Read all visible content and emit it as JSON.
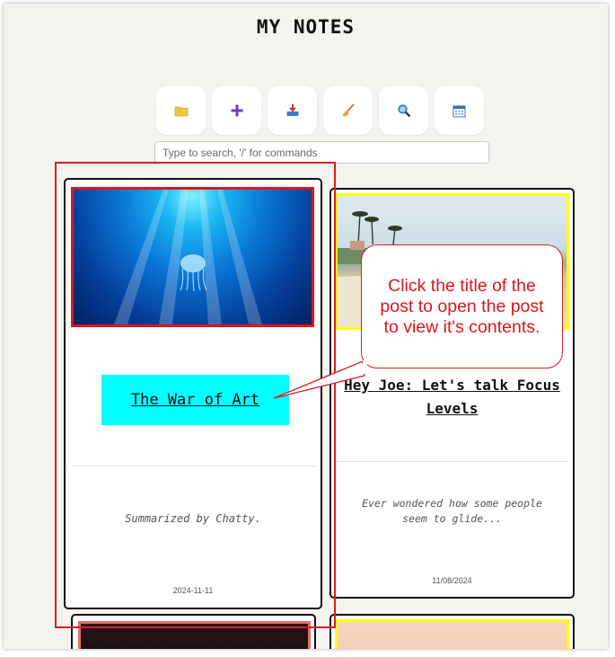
{
  "app": {
    "title": "MY NOTES"
  },
  "toolbar": {
    "buttons": [
      {
        "name": "folder",
        "icon": "folder-icon"
      },
      {
        "name": "add",
        "icon": "plus-icon"
      },
      {
        "name": "inbox",
        "icon": "inbox-tray-icon"
      },
      {
        "name": "clean",
        "icon": "broom-icon"
      },
      {
        "name": "search",
        "icon": "magnifier-icon"
      },
      {
        "name": "calendar",
        "icon": "calendar-icon"
      }
    ]
  },
  "search": {
    "placeholder": "Type to search, '/' for commands",
    "value": ""
  },
  "cards": [
    {
      "title": "The War of Art",
      "summary": "Summarized by Chatty.",
      "date": "2024-11-11",
      "image": "jellyfish-ocean-image"
    },
    {
      "title": "Hey Joe: Let's talk Focus Levels",
      "summary": "Ever wondered how some people seem to glide...",
      "date": "11/08/2024",
      "image": "palm-trees-beach-image"
    }
  ],
  "annotation": {
    "callout_text": "Click the title of the post to open the post to view it's contents.",
    "color": "#d61f26"
  },
  "colors": {
    "background": "#f3f3f0",
    "title_highlight": "#00ffff",
    "image_border_red": "#e0141b",
    "image_border_yellow": "#ffff00"
  }
}
